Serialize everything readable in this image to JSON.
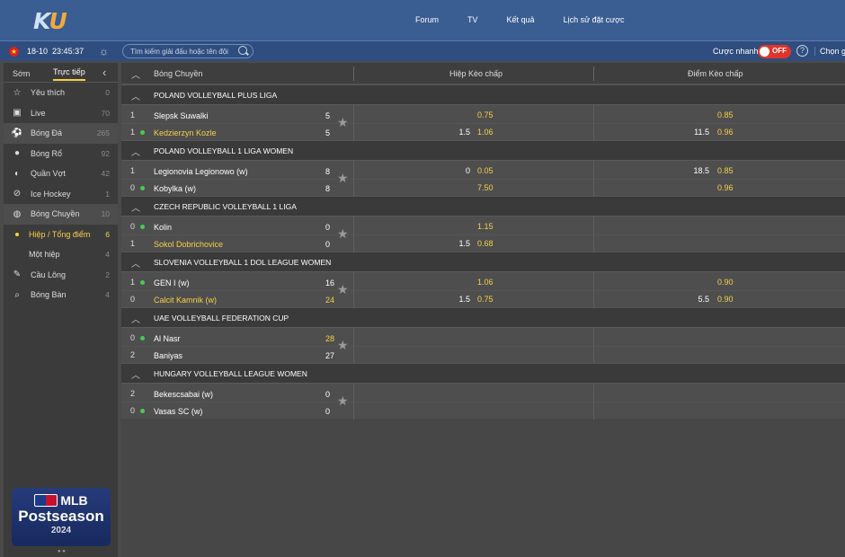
{
  "header": {
    "logo": {
      "k": "K",
      "u": "U"
    },
    "nav": [
      "Forum",
      "TV",
      "Kết quả",
      "Lịch sử đặt cược"
    ]
  },
  "subbar": {
    "date": "18-10",
    "time": "23:45:37",
    "search_placeholder": "Tìm kiếm giải đấu hoặc tên đội",
    "quick_bet_label": "Cược nhanh",
    "toggle_state": "OFF",
    "help": "?",
    "choose_label": "Chọn gi"
  },
  "sidebar": {
    "tabs": {
      "early": "Sớm",
      "live": "Trực tiếp"
    },
    "items": [
      {
        "icon": "☆",
        "label": "Yêu thích",
        "count": "0"
      },
      {
        "icon": "▣",
        "label": "Live",
        "count": "70"
      },
      {
        "icon": "⚽",
        "label": "Bóng Đá",
        "count": "265",
        "active": true
      },
      {
        "icon": "●",
        "label": "Bóng Rổ",
        "count": "92"
      },
      {
        "icon": "◐",
        "label": "Quần Vợt",
        "count": "42"
      },
      {
        "icon": "⊘",
        "label": "Ice Hockey",
        "count": "1"
      },
      {
        "icon": "◍",
        "label": "Bóng Chuyền",
        "count": "10",
        "active": true
      }
    ],
    "subitems": [
      {
        "label": "Hiệp / Tổng điểm",
        "count": "6"
      },
      {
        "label": "Một hiệp",
        "count": "4"
      }
    ],
    "items2": [
      {
        "icon": "✎",
        "label": "Cầu Lông",
        "count": "2"
      },
      {
        "icon": "⌕",
        "label": "Bóng Bàn",
        "count": "4"
      }
    ],
    "banner": {
      "line1": "MLB",
      "line2": "Postseason",
      "line3": "2024"
    }
  },
  "main": {
    "header": {
      "sport": "Bóng Chuyền",
      "col1": "Hiệp Kèo chấp",
      "col2": "Điểm Kèo chấp"
    },
    "leagues": [
      {
        "name": "POLAND VOLLEYBALL PLUS LIGA",
        "match": {
          "home": {
            "num": "1",
            "dot": false,
            "team": "Slepsk Suwalki",
            "hl": false,
            "score": "5",
            "shl": false,
            "hc1": "",
            "od1": "0.75",
            "hc2": "",
            "od2": "0.85"
          },
          "away": {
            "num": "1",
            "dot": true,
            "team": "Kedzierzyn Kozle",
            "hl": true,
            "score": "5",
            "shl": false,
            "hc1": "1.5",
            "od1": "1.06",
            "hc2": "11.5",
            "od2": "0.96"
          }
        }
      },
      {
        "name": "POLAND VOLLEYBALL 1 LIGA WOMEN",
        "match": {
          "home": {
            "num": "1",
            "dot": false,
            "team": "Legionovia Legionowo (w)",
            "hl": false,
            "score": "8",
            "shl": false,
            "hc1": "0",
            "od1": "0.05",
            "hc2": "18.5",
            "od2": "0.85"
          },
          "away": {
            "num": "0",
            "dot": true,
            "team": "Kobylka (w)",
            "hl": false,
            "score": "8",
            "shl": false,
            "hc1": "",
            "od1": "7.50",
            "hc2": "",
            "od2": "0.96"
          }
        }
      },
      {
        "name": "CZECH REPUBLIC VOLLEYBALL 1 LIGA",
        "match": {
          "home": {
            "num": "0",
            "dot": true,
            "team": "Kolin",
            "hl": false,
            "score": "0",
            "shl": false,
            "hc1": "",
            "od1": "1.15",
            "hc2": "",
            "od2": ""
          },
          "away": {
            "num": "1",
            "dot": false,
            "team": "Sokol Dobrichovice",
            "hl": true,
            "score": "0",
            "shl": false,
            "hc1": "1.5",
            "od1": "0.68",
            "hc2": "",
            "od2": ""
          }
        }
      },
      {
        "name": "SLOVENIA VOLLEYBALL 1 DOL LEAGUE WOMEN",
        "match": {
          "home": {
            "num": "1",
            "dot": true,
            "team": "GEN I (w)",
            "hl": false,
            "score": "16",
            "shl": false,
            "hc1": "",
            "od1": "1.06",
            "hc2": "",
            "od2": "0.90"
          },
          "away": {
            "num": "0",
            "dot": false,
            "team": "Calcit Kamnik (w)",
            "hl": true,
            "score": "24",
            "shl": true,
            "hc1": "1.5",
            "od1": "0.75",
            "hc2": "5.5",
            "od2": "0.90"
          }
        }
      },
      {
        "name": "UAE VOLLEYBALL FEDERATION CUP",
        "match": {
          "home": {
            "num": "0",
            "dot": true,
            "team": "Al Nasr",
            "hl": false,
            "score": "28",
            "shl": true,
            "hc1": "",
            "od1": "",
            "hc2": "",
            "od2": ""
          },
          "away": {
            "num": "2",
            "dot": false,
            "team": "Baniyas",
            "hl": false,
            "score": "27",
            "shl": false,
            "hc1": "",
            "od1": "",
            "hc2": "",
            "od2": ""
          }
        }
      },
      {
        "name": "HUNGARY VOLLEYBALL LEAGUE WOMEN",
        "match": {
          "home": {
            "num": "2",
            "dot": false,
            "team": "Bekescsabai (w)",
            "hl": false,
            "score": "0",
            "shl": false,
            "hc1": "",
            "od1": "",
            "hc2": "",
            "od2": ""
          },
          "away": {
            "num": "0",
            "dot": true,
            "team": "Vasas SC (w)",
            "hl": false,
            "score": "0",
            "shl": false,
            "hc1": "",
            "od1": "",
            "hc2": "",
            "od2": ""
          }
        }
      }
    ]
  }
}
